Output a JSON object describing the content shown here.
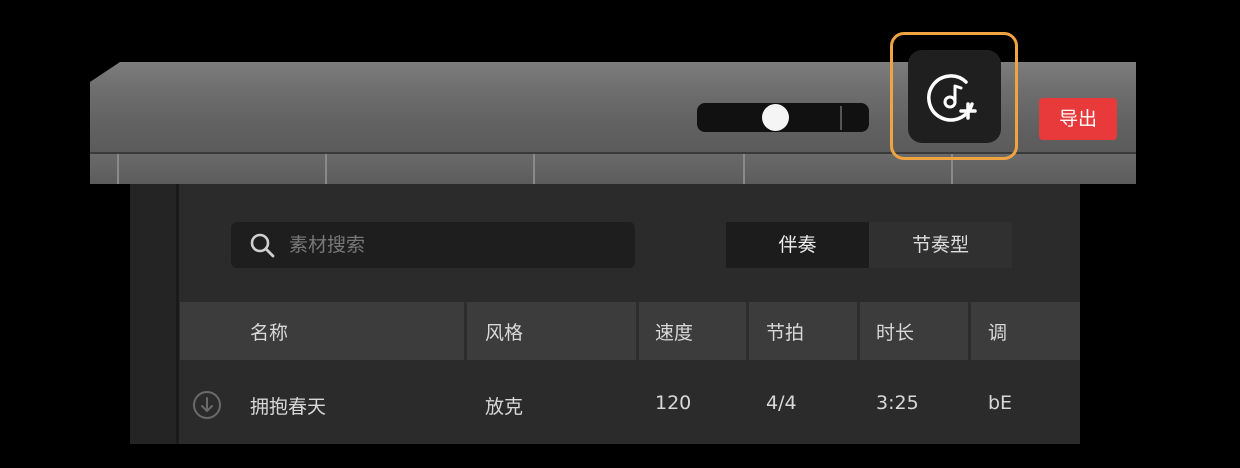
{
  "toolbar": {
    "export_label": "导出",
    "add_music_icon": "music-note-add-icon",
    "slider_icon": "volume-slider"
  },
  "search": {
    "placeholder": "素材搜索"
  },
  "tabs": [
    {
      "label": "伴奏",
      "active": true
    },
    {
      "label": "节奏型",
      "active": false
    }
  ],
  "table": {
    "columns": [
      "名称",
      "风格",
      "速度",
      "节拍",
      "时长",
      "调"
    ],
    "rows": [
      {
        "name": "拥抱春天",
        "style": "放克",
        "tempo": "120",
        "meter": "4/4",
        "duration": "3:25",
        "key": "bE"
      }
    ]
  },
  "colors": {
    "accent_highlight": "#f0a341",
    "export_red": "#e83a3a"
  }
}
